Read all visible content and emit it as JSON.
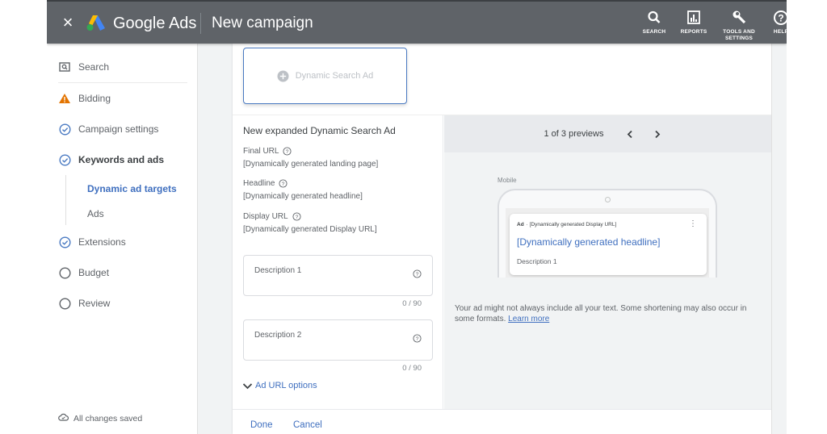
{
  "header": {
    "close_label": "×",
    "brand": "Google Ads",
    "title": "New campaign",
    "tools": [
      {
        "label": "SEARCH",
        "icon": "search-icon"
      },
      {
        "label": "REPORTS",
        "icon": "reports-icon"
      },
      {
        "label": "TOOLS AND SETTINGS",
        "icon": "wrench-icon"
      },
      {
        "label": "HELP",
        "icon": "help-icon"
      }
    ]
  },
  "sidebar": {
    "items": [
      {
        "label": "Search",
        "icon": "search-campaign-icon",
        "status": "campaign-type"
      },
      {
        "label": "Bidding",
        "icon": "warning-icon",
        "status": "warning"
      },
      {
        "label": "Campaign settings",
        "icon": "check-circle-icon",
        "status": "complete"
      },
      {
        "label": "Keywords and ads",
        "icon": "check-circle-icon",
        "status": "complete"
      },
      {
        "label": "Extensions",
        "icon": "check-circle-icon",
        "status": "complete"
      },
      {
        "label": "Budget",
        "icon": "empty-circle-icon",
        "status": "incomplete"
      },
      {
        "label": "Review",
        "icon": "empty-circle-icon",
        "status": "incomplete"
      }
    ],
    "subitems": [
      {
        "label": "Dynamic ad targets",
        "active": true
      },
      {
        "label": "Ads",
        "active": false
      }
    ],
    "saved_status": "All changes saved"
  },
  "main": {
    "ad_type_tile": "Dynamic Search Ad",
    "form": {
      "title": "New expanded Dynamic Search Ad",
      "fields": [
        {
          "label": "Final URL",
          "value": "[Dynamically generated landing page]"
        },
        {
          "label": "Headline",
          "value": "[Dynamically generated headline]"
        },
        {
          "label": "Display URL",
          "value": "[Dynamically generated Display URL]"
        }
      ],
      "descriptions": [
        {
          "placeholder": "Description 1",
          "value": "",
          "counter": "0 / 90"
        },
        {
          "placeholder": "Description 2",
          "value": "",
          "counter": "0 / 90"
        }
      ],
      "url_options": "Ad URL options"
    },
    "preview": {
      "count_text": "1 of 3 previews",
      "device_label": "Mobile",
      "ad_badge": "Ad",
      "ad_display_url": "· [Dynamically generated Display URL]",
      "ad_headline": "[Dynamically generated headline]",
      "ad_description": "Description 1",
      "disclaimer": "Your ad might not always include all your text. Some shortening may also occur in some formats.",
      "learn_more": "Learn more"
    },
    "actions": {
      "done": "Done",
      "cancel": "Cancel"
    }
  },
  "colors": {
    "header_bg": "#5f6368",
    "accent_blue": "#3f6fbf",
    "warning_orange": "#e37400",
    "check_blue": "#4a7ac2"
  }
}
